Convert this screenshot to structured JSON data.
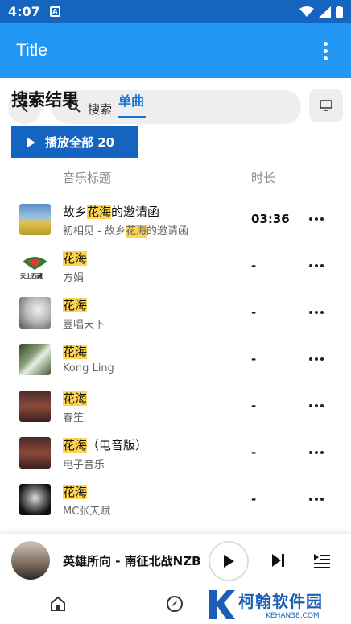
{
  "status_bar": {
    "time": "4:07",
    "notif_letter": "A"
  },
  "app_bar": {
    "title": "Title"
  },
  "search": {
    "heading": "搜索结果",
    "query_label": "搜索",
    "tab_label": "单曲"
  },
  "play_all": {
    "label": "播放全部 20"
  },
  "columns": {
    "title": "音乐标题",
    "duration": "时长"
  },
  "tracks": [
    {
      "t_pre": "故乡",
      "t_hl": "花海",
      "t_post": "的邀请函",
      "s_pre": "初相见 - 故乡",
      "s_hl": "花海",
      "s_post": "的邀请函",
      "duration": "03:36"
    },
    {
      "t_pre": "",
      "t_hl": "花海",
      "t_post": "",
      "s_pre": "方娟",
      "s_hl": "",
      "s_post": "",
      "duration": "-"
    },
    {
      "t_pre": "",
      "t_hl": "花海",
      "t_post": "",
      "s_pre": "壹唱天下",
      "s_hl": "",
      "s_post": "",
      "duration": "-"
    },
    {
      "t_pre": "",
      "t_hl": "花海",
      "t_post": "",
      "s_pre": "Kong Ling",
      "s_hl": "",
      "s_post": "",
      "duration": "-"
    },
    {
      "t_pre": "",
      "t_hl": "花海",
      "t_post": "",
      "s_pre": "春笙",
      "s_hl": "",
      "s_post": "",
      "duration": "-"
    },
    {
      "t_pre": "",
      "t_hl": "花海",
      "t_post": "（电音版）",
      "s_pre": "电子音乐",
      "s_hl": "",
      "s_post": "",
      "duration": "-"
    },
    {
      "t_pre": "",
      "t_hl": "花海",
      "t_post": "",
      "s_pre": "MC张天赋",
      "s_hl": "",
      "s_post": "",
      "duration": "-"
    }
  ],
  "art_logo_text": "天上西藏",
  "now_playing": {
    "title": "英雄所向 - 南征北战NZBZ"
  },
  "watermark": {
    "name": "柯翰软件园",
    "url": "KEHAN38.COM"
  },
  "colors": {
    "status_bar": "#1565C0",
    "app_bar": "#2196F3",
    "accent": "#1976D2",
    "highlight": "#FFD54F"
  }
}
